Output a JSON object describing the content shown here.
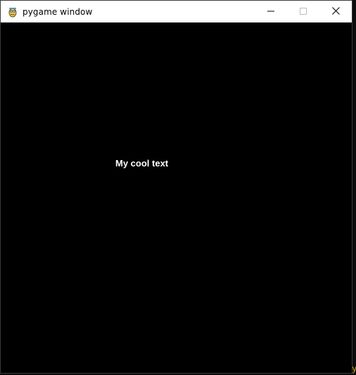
{
  "window": {
    "title": "pygame window",
    "app_icon": "pygame-snake-icon",
    "controls": {
      "minimize_icon": "minimize-icon",
      "maximize_icon": "maximize-icon",
      "close_icon": "close-icon"
    }
  },
  "canvas": {
    "background": "#000000",
    "text": "My cool text",
    "text_color": "#ffffff"
  },
  "background_terminal": {
    "fragment_right": "y"
  },
  "colors": {
    "titlebar": "#ffffff",
    "canvas": "#000000",
    "terminal_accent": "#c7a317"
  }
}
